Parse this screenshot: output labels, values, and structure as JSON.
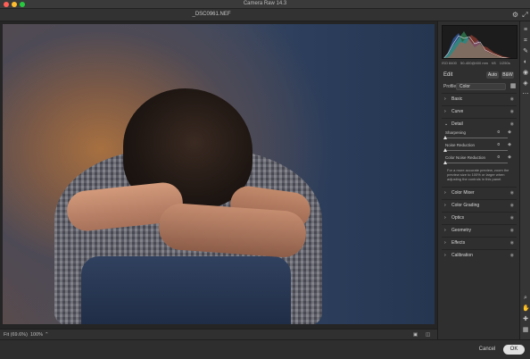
{
  "window": {
    "title": "Camera Raw 14.3",
    "file_name": "_DSC0961.NEF",
    "traffic_lights": [
      "#ff5f56",
      "#ffbd2e",
      "#27c93f"
    ]
  },
  "histogram": {
    "meta": [
      "ISO 8400",
      "50-400@400 mm",
      "f/8",
      "1/250s"
    ]
  },
  "edit": {
    "label": "Edit",
    "auto_label": "Auto",
    "bw_label": "B&W",
    "profile_label": "Profile",
    "profile_value": "Color"
  },
  "sections": {
    "basic": "Basic",
    "curve": "Curve",
    "detail": "Detail",
    "color_mixer": "Color Mixer",
    "color_grading": "Color Grading",
    "optics": "Optics",
    "geometry": "Geometry",
    "effects": "Effects",
    "calibration": "Calibration"
  },
  "detail": {
    "sharpening": {
      "label": "Sharpening",
      "value": "0"
    },
    "noise_reduction": {
      "label": "Noise Reduction",
      "value": "0"
    },
    "color_noise_reduction": {
      "label": "Color Noise Reduction",
      "value": "0"
    },
    "tip": "For a more accurate preview, zoom the preview size to 100% or larger when adjusting the controls in this panel."
  },
  "statusbar": {
    "fit": "Fit (69.6%)",
    "zoom": "100%"
  },
  "buttons": {
    "cancel": "Cancel",
    "ok": "OK"
  },
  "icons": {
    "settings": "gear-icon",
    "fullscreen": "expand-icon",
    "grid": "grid-icon",
    "eye": "eye-icon"
  },
  "colors": {
    "accent": "#4c8cd8",
    "panel_bg": "#2f2f2f"
  }
}
